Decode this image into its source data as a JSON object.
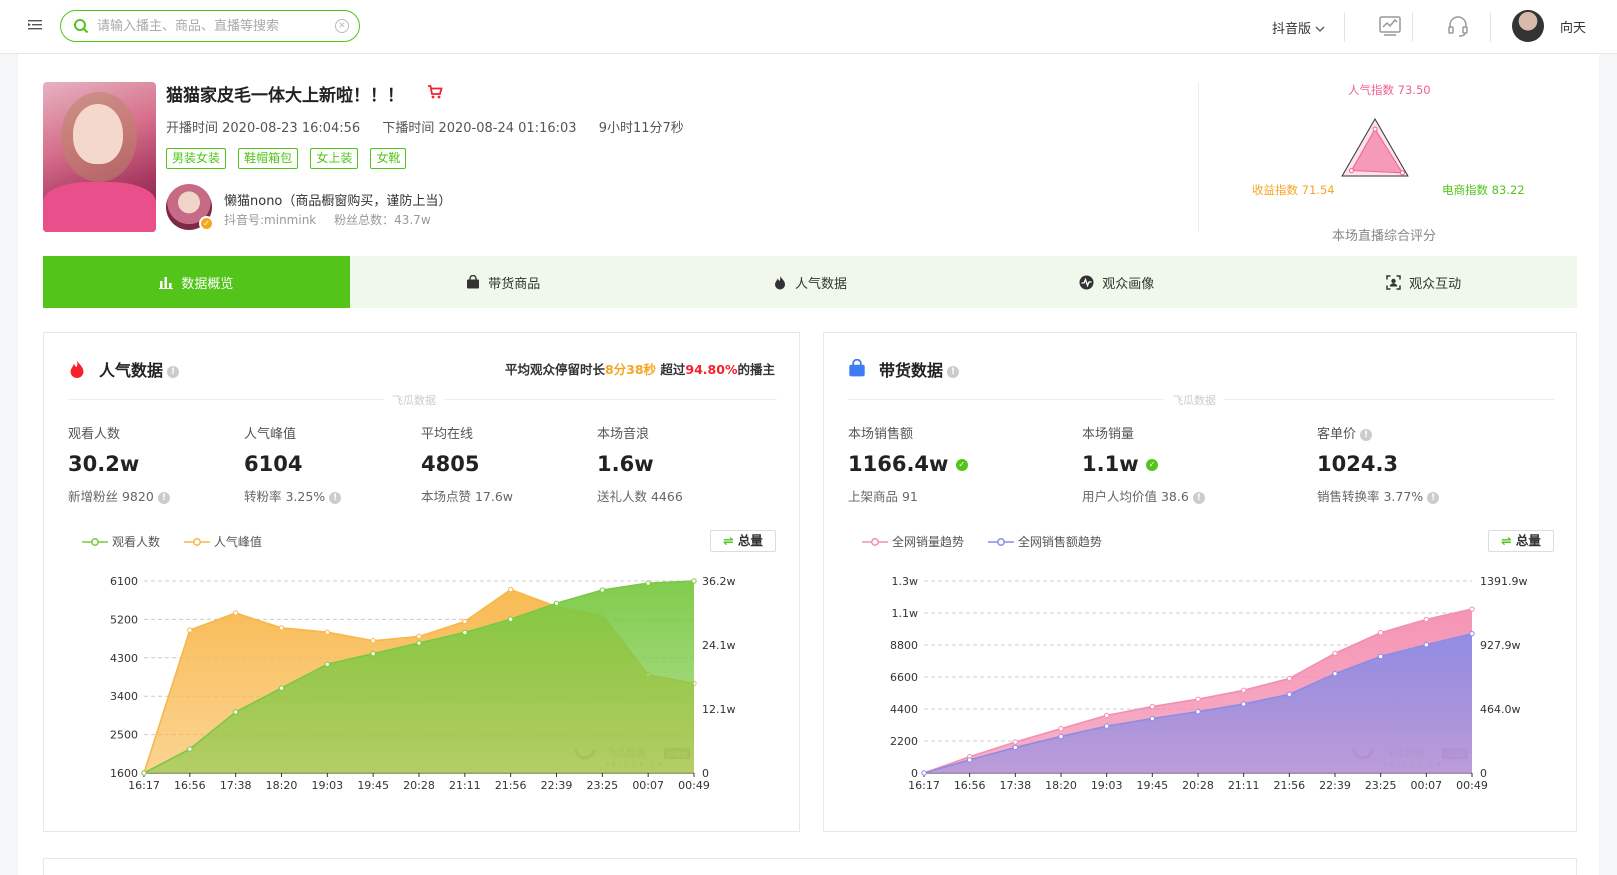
{
  "topbar": {
    "search_placeholder": "请输入播主、商品、直播等搜索",
    "version": "抖音版",
    "user_name": "向天"
  },
  "live": {
    "title": "猫猫家皮毛一体大上新啦！！！",
    "start_time": "开播时间 2020-08-23 16:04:56",
    "end_time": "下播时间 2020-08-24 01:16:03",
    "duration": "9小时11分7秒",
    "tags": [
      "男装女装",
      "鞋帽箱包",
      "女上装",
      "女靴"
    ],
    "anchor_name": "懒猫nono（商品橱窗购买，谨防上当）",
    "anchor_id": "抖音号:minmink",
    "fans": "粉丝总数：43.7w"
  },
  "score": {
    "popularity": "人气指数 73.50",
    "income": "收益指数 71.54",
    "ecommerce": "电商指数 83.22",
    "caption": "本场直播综合评分",
    "popularity_value": 73.5,
    "income_value": 71.54,
    "ecommerce_value": 83.22
  },
  "tabs": [
    "数据概览",
    "带货商品",
    "人气数据",
    "观众画像",
    "观众互动"
  ],
  "pop_panel": {
    "title": "人气数据",
    "stay_prefix": "平均观众停留时长",
    "stay_time": "8分38秒",
    "stay_mid": " 超过",
    "stay_pct": "94.80%",
    "stay_suffix": "的播主",
    "watermark": "飞瓜数据",
    "metrics": [
      {
        "label": "观看人数",
        "value": "30.2w",
        "sub": "新增粉丝 9820"
      },
      {
        "label": "人气峰值",
        "value": "6104",
        "sub": "转粉率 3.25%"
      },
      {
        "label": "平均在线",
        "value": "4805",
        "sub": "本场点赞 17.6w"
      },
      {
        "label": "本场音浪",
        "value": "1.6w",
        "sub": "送礼人数 4466"
      }
    ],
    "legend": [
      "观看人数",
      "人气峰值"
    ],
    "total_btn": "总量",
    "colors": {
      "viewers": "#7ac943",
      "peak": "#f8b74a"
    }
  },
  "sales_panel": {
    "title": "带货数据",
    "watermark": "飞瓜数据",
    "metrics": [
      {
        "label": "本场销售额",
        "value": "1166.4w",
        "sub": "上架商品 91"
      },
      {
        "label": "本场销量",
        "value": "1.1w",
        "sub": "用户人均价值 38.6"
      },
      {
        "label": "客单价",
        "value": "1024.3",
        "sub": "销售转换率 3.77%"
      }
    ],
    "legend": [
      "全网销量趋势",
      "全网销售额趋势"
    ],
    "total_btn": "总量",
    "colors": {
      "volume": "#f48fb1",
      "amount": "#8c8ce6"
    }
  },
  "chart_data": [
    {
      "type": "area",
      "x": [
        "16:17",
        "16:56",
        "17:38",
        "18:20",
        "19:03",
        "19:45",
        "20:28",
        "21:11",
        "21:56",
        "22:39",
        "23:25",
        "00:07",
        "00:49"
      ],
      "y_left_ticks": [
        "1600",
        "2500",
        "3400",
        "4300",
        "5200",
        "6100"
      ],
      "y_right_ticks": [
        "0",
        "12.1w",
        "24.1w",
        "36.2w"
      ],
      "ylim_left": [
        1600,
        6100
      ],
      "ylim_right": [
        0,
        36.2
      ],
      "series": [
        {
          "name": "观看人数",
          "axis": "right",
          "values": [
            0,
            4.5,
            11.5,
            16,
            20.5,
            22.5,
            24.5,
            26.5,
            29,
            32,
            34.5,
            35.8,
            36.2
          ]
        },
        {
          "name": "人气峰值",
          "axis": "left",
          "values": [
            1600,
            4950,
            5350,
            5000,
            4900,
            4700,
            4800,
            5150,
            5900,
            5500,
            5300,
            3900,
            3700
          ]
        }
      ],
      "watermark": "飞瓜数据",
      "watermark_sub": "FEIGUA.CN",
      "watermark_badge": "抖音版"
    },
    {
      "type": "area",
      "x": [
        "16:17",
        "16:56",
        "17:38",
        "18:20",
        "19:03",
        "19:45",
        "20:28",
        "21:11",
        "21:56",
        "22:39",
        "23:25",
        "00:07",
        "00:49"
      ],
      "y_left_ticks": [
        "0",
        "2200",
        "4400",
        "6600",
        "8800",
        "1.1w",
        "1.3w"
      ],
      "y_right_ticks": [
        "0",
        "464.0w",
        "927.9w",
        "1391.9w"
      ],
      "ylim_left": [
        0,
        13000
      ],
      "ylim_right": [
        0,
        1391.9
      ],
      "series": [
        {
          "name": "全网销量趋势",
          "axis": "left",
          "values": [
            0,
            1100,
            2100,
            3000,
            3900,
            4500,
            5000,
            5600,
            6400,
            8100,
            9500,
            10400,
            11100
          ]
        },
        {
          "name": "全网销售额趋势",
          "axis": "right",
          "values": [
            0,
            95,
            185,
            265,
            340,
            395,
            445,
            500,
            570,
            720,
            845,
            930,
            1010
          ]
        }
      ],
      "watermark": "飞瓜数据",
      "watermark_sub": "FEIGUA.CN",
      "watermark_badge": "抖音版"
    }
  ]
}
